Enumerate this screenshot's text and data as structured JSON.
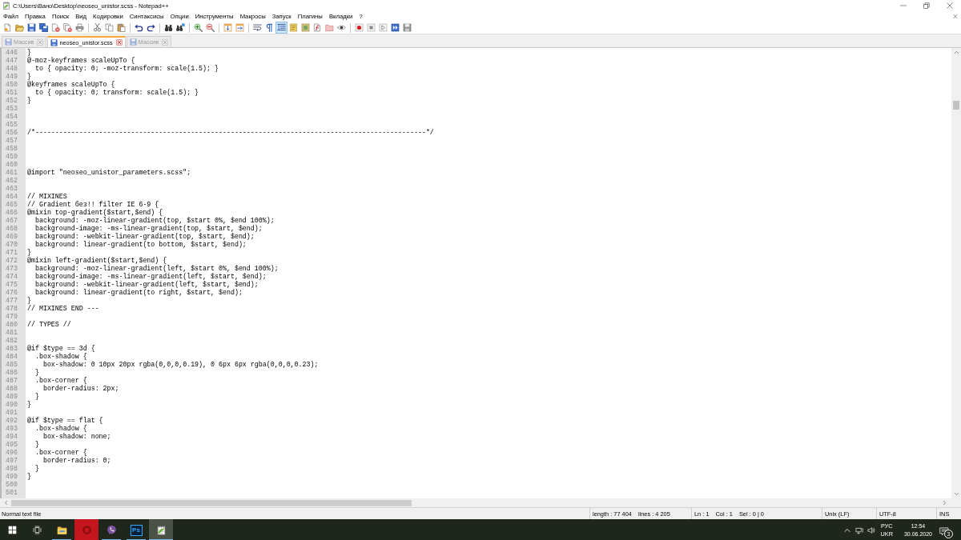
{
  "window": {
    "title": "C:\\Users\\Вано\\Desktop\\neoseo_unistor.scss - Notepad++"
  },
  "menu": [
    "Файл",
    "Правка",
    "Поиск",
    "Вид",
    "Кодировки",
    "Синтаксисы",
    "Опции",
    "Инструменты",
    "Макросы",
    "Запуск",
    "Плагины",
    "Вкладки",
    "?"
  ],
  "toolbar": [
    [
      {
        "kind": "new-file",
        "on": false
      },
      {
        "kind": "open-folder",
        "on": false
      },
      {
        "kind": "save",
        "on": false
      },
      {
        "kind": "save-all",
        "on": false
      },
      {
        "kind": "close-file",
        "on": false
      },
      {
        "kind": "close-all",
        "on": false
      },
      {
        "kind": "print",
        "on": false
      }
    ],
    [
      {
        "kind": "cut",
        "on": false
      },
      {
        "kind": "copy",
        "on": false
      },
      {
        "kind": "paste",
        "on": false
      }
    ],
    [
      {
        "kind": "undo",
        "on": false
      },
      {
        "kind": "redo",
        "on": false
      }
    ],
    [
      {
        "kind": "binoculars",
        "on": false
      },
      {
        "kind": "replace",
        "on": false
      }
    ],
    [
      {
        "kind": "zoom-in",
        "on": false
      },
      {
        "kind": "zoom-out",
        "on": false
      }
    ],
    [
      {
        "kind": "sync-vertical",
        "on": false
      },
      {
        "kind": "sync-horizontal",
        "on": false
      }
    ],
    [
      {
        "kind": "word-wrap",
        "on": false
      },
      {
        "kind": "pilcrow",
        "on": false
      },
      {
        "kind": "indent-guide",
        "on": true
      },
      {
        "kind": "notebook",
        "on": false
      },
      {
        "kind": "document-map",
        "on": false
      },
      {
        "kind": "function-list",
        "on": false
      },
      {
        "kind": "folder",
        "on": false
      },
      {
        "kind": "eye",
        "on": false
      }
    ],
    [
      {
        "kind": "record",
        "on": false
      },
      {
        "kind": "stop",
        "on": false
      },
      {
        "kind": "play",
        "on": false
      },
      {
        "kind": "fast-forward",
        "on": false
      },
      {
        "kind": "save-macro",
        "on": false
      }
    ]
  ],
  "tabs": [
    {
      "label": "Массив",
      "selected": false
    },
    {
      "label": "neoseo_unistor.scss",
      "selected": true
    },
    {
      "label": "Массив",
      "selected": false
    }
  ],
  "editor": {
    "lines": [
      {
        "number": "446",
        "text": "}"
      },
      {
        "number": "447",
        "text": "@-moz-keyframes scaleUpTo {"
      },
      {
        "number": "448",
        "text": "  to { opacity: 0; -moz-transform: scale(1.5); }"
      },
      {
        "number": "449",
        "text": "}"
      },
      {
        "number": "450",
        "text": "@keyframes scaleUpTo {"
      },
      {
        "number": "451",
        "text": "  to { opacity: 0; transform: scale(1.5); }"
      },
      {
        "number": "452",
        "text": "}"
      },
      {
        "number": "453"
      },
      {
        "number": "454"
      },
      {
        "number": "455"
      },
      {
        "number": "456",
        "text": "/*--------------------------------------------------------------------------------------------------*/"
      },
      {
        "number": "457"
      },
      {
        "number": "458"
      },
      {
        "number": "459"
      },
      {
        "number": "460"
      },
      {
        "number": "461",
        "text": "@import \"neoseo_unistor_parameters.scss\";"
      },
      {
        "number": "462"
      },
      {
        "number": "463"
      },
      {
        "number": "464",
        "text": "// MIXINES"
      },
      {
        "number": "465",
        "text": "// Gradient без!! filter IE 6-9 {"
      },
      {
        "number": "466",
        "text": "@mixin top-gradient($start,$end) {"
      },
      {
        "number": "467",
        "text": "  background: -moz-linear-gradient(top, $start 0%, $end 100%);"
      },
      {
        "number": "468",
        "text": "  background-image: -ms-linear-gradient(top, $start, $end);"
      },
      {
        "number": "469",
        "text": "  background: -webkit-linear-gradient(top, $start, $end);"
      },
      {
        "number": "470",
        "text": "  background: linear-gradient(to bottom, $start, $end);"
      },
      {
        "number": "471",
        "text": "}"
      },
      {
        "number": "472",
        "text": "@mixin left-gradient($start,$end) {"
      },
      {
        "number": "473",
        "text": "  background: -moz-linear-gradient(left, $start 0%, $end 100%);"
      },
      {
        "number": "474",
        "text": "  background-image: -ms-linear-gradient(left, $start, $end);"
      },
      {
        "number": "475",
        "text": "  background: -webkit-linear-gradient(left, $start, $end);"
      },
      {
        "number": "476",
        "text": "  background: linear-gradient(to right, $start, $end);"
      },
      {
        "number": "477",
        "text": "}"
      },
      {
        "number": "478",
        "text": "// MIXINES END ---"
      },
      {
        "number": "479"
      },
      {
        "number": "480",
        "text": "// TYPES //"
      },
      {
        "number": "481"
      },
      {
        "number": "482"
      },
      {
        "number": "483",
        "text": "@if $type == 3d {"
      },
      {
        "number": "484",
        "text": "  .box-shadow {"
      },
      {
        "number": "485",
        "text": "    box-shadow: 0 10px 20px rgba(0,0,0,0.19), 0 6px 6px rgba(0,0,0,0.23);"
      },
      {
        "number": "486",
        "text": "  }"
      },
      {
        "number": "487",
        "text": "  .box-corner {"
      },
      {
        "number": "488",
        "text": "    border-radius: 2px;"
      },
      {
        "number": "489",
        "text": "  }"
      },
      {
        "number": "490",
        "text": "}"
      },
      {
        "number": "491"
      },
      {
        "number": "492",
        "text": "@if $type == flat {"
      },
      {
        "number": "493",
        "text": "  .box-shadow {"
      },
      {
        "number": "494",
        "text": "    box-shadow: none;"
      },
      {
        "number": "495",
        "text": "  }"
      },
      {
        "number": "496",
        "text": "  .box-corner {"
      },
      {
        "number": "497",
        "text": "    border-radius: 0;"
      },
      {
        "number": "498",
        "text": "  }"
      },
      {
        "number": "499",
        "text": "}"
      },
      {
        "number": "500"
      },
      {
        "number": "501"
      }
    ]
  },
  "status_bar": {
    "file_type": "Normal text file",
    "length": "length : 77 404",
    "lines": "lines : 4 205",
    "position_line": "Ln : 1",
    "position_column": "Col : 1",
    "selection": "Sel : 0 | 0",
    "line_ending": "Unix (LF)",
    "encoding": "UTF-8",
    "insert_mode": "INS"
  },
  "taskbar": {
    "apps": [
      {
        "kind": "file-folder",
        "running": true,
        "selected": false,
        "highlighted": false
      },
      {
        "kind": "ring",
        "running": false,
        "selected": false,
        "highlighted": true
      },
      {
        "kind": "phone-bubble",
        "running": true,
        "selected": false,
        "highlighted": false
      },
      {
        "kind": "text-tile",
        "label": "Ps",
        "running": true,
        "selected": false,
        "highlighted": false
      },
      {
        "kind": "notepad",
        "running": true,
        "selected": true,
        "highlighted": false
      }
    ],
    "language": {
      "code": "РУС",
      "layout": "UKR"
    },
    "clock": {
      "time": "12:54",
      "date": "30.06.2020"
    },
    "notification_count": "3"
  }
}
